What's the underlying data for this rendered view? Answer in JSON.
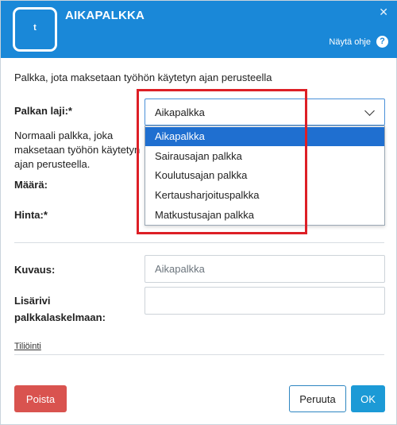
{
  "header": {
    "logo_letter": "t",
    "title": "AIKAPALKKA",
    "close_glyph": "✕",
    "help_label": "Näytä ohje",
    "help_glyph": "?"
  },
  "intro_text": "Palkka, jota maksetaan työhön käytetyn ajan perusteella",
  "salary_type": {
    "label": "Palkan laji:*",
    "selected": "Aikapalkka",
    "description": "Normaali palkka, joka maksetaan työhön käytetyn ajan perusteella.",
    "options": [
      "Aikapalkka",
      "Sairausajan palkka",
      "Koulutusajan palkka",
      "Kertausharjoituspalkka",
      "Matkustusajan palkka"
    ]
  },
  "amount_label": "Määrä:",
  "price_label": "Hinta:*",
  "description_field": {
    "label": "Kuvaus:",
    "placeholder": "Aikapalkka",
    "value": ""
  },
  "extra_row": {
    "label_line1": "Lisärivi",
    "label_line2": "palkkalaskelmaan:",
    "value": ""
  },
  "accounting_link": "Tiliöinti",
  "buttons": {
    "delete": "Poista",
    "cancel": "Peruuta",
    "ok": "OK"
  },
  "colors": {
    "header_bg": "#1a88d8",
    "selected_option_bg": "#1f6fd0",
    "delete_button": "#d9534f",
    "ok_button": "#1c9ad6",
    "highlight_border": "#dd1f26"
  }
}
